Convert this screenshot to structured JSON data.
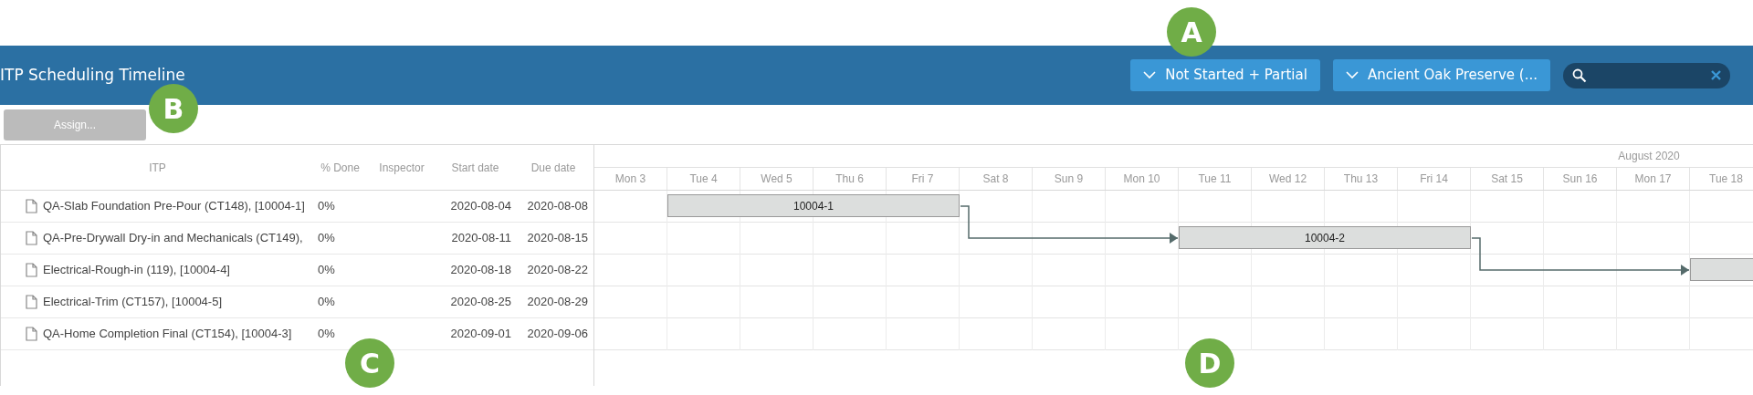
{
  "header": {
    "title": "ITP Scheduling Timeline",
    "filters": [
      {
        "label": "Not Started + Partial"
      },
      {
        "label": "Ancient Oak Preserve (..."
      }
    ],
    "search": {
      "clearable": true
    }
  },
  "toolbar": {
    "assign_button": {
      "label": "Assign...",
      "disabled": true
    }
  },
  "grid": {
    "columns": [
      "ITP",
      "% Done",
      "Inspector",
      "Start date",
      "Due date"
    ],
    "rows": [
      {
        "itp": "QA-Slab Foundation Pre-Pour (CT148), [10004-1]",
        "done": "0%",
        "start": "2020-08-04",
        "due": "2020-08-08",
        "bar_label": "10004-1"
      },
      {
        "itp": "QA-Pre-Drywall Dry-in and Mechanicals (CT149),",
        "done": "0%",
        "start": "2020-08-11",
        "due": "2020-08-15",
        "bar_label": "10004-2"
      },
      {
        "itp": "Electrical-Rough-in (119), [10004-4]",
        "done": "0%",
        "start": "2020-08-18",
        "due": "2020-08-22"
      },
      {
        "itp": "Electrical-Trim (CT157), [10004-5]",
        "done": "0%",
        "start": "2020-08-25",
        "due": "2020-08-29"
      },
      {
        "itp": "QA-Home Completion Final (CT154), [10004-3]",
        "done": "0%",
        "start": "2020-09-01",
        "due": "2020-09-06"
      }
    ]
  },
  "timeline": {
    "month": "August 2020",
    "days": [
      "Mon 3",
      "Tue 4",
      "Wed 5",
      "Thu 6",
      "Fri 7",
      "Sat 8",
      "Sun 9",
      "Mon 10",
      "Tue 11",
      "Wed 12",
      "Thu 13",
      "Fri 14",
      "Sat 15",
      "Sun 16",
      "Mon 17",
      "Tue 18"
    ]
  },
  "callouts": [
    {
      "label": "A"
    },
    {
      "label": "B"
    },
    {
      "label": "C"
    },
    {
      "label": "D"
    }
  ]
}
